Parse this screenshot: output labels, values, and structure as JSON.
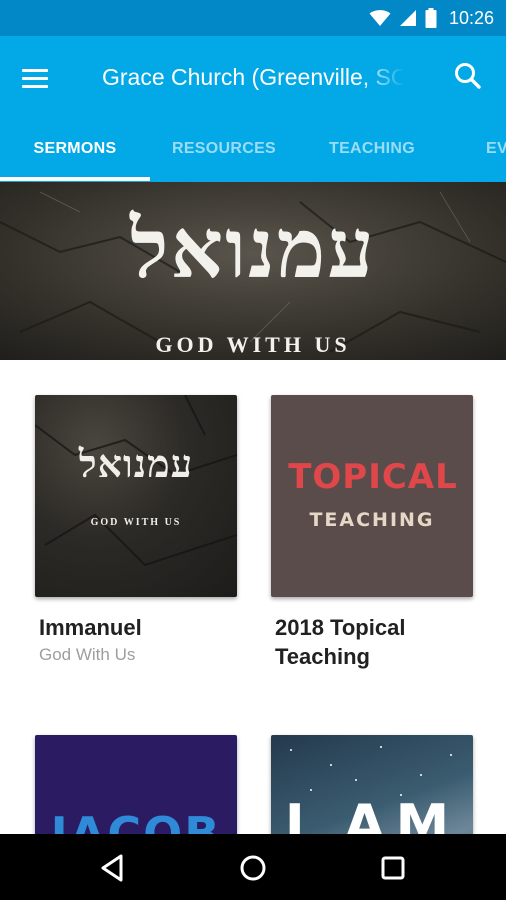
{
  "status_bar": {
    "time": "10:26"
  },
  "app_bar": {
    "title": "Grace Church (Greenville, SC)"
  },
  "tabs": [
    {
      "label": "SERMONS",
      "active": true
    },
    {
      "label": "RESOURCES",
      "active": false
    },
    {
      "label": "TEACHING",
      "active": false
    },
    {
      "label": "EVENTS",
      "active": false
    }
  ],
  "hero": {
    "hebrew": "עמנואל",
    "subtitle": "GOD WITH US"
  },
  "series": [
    {
      "title": "Immanuel",
      "subtitle": "God With Us",
      "art_hebrew": "עמנואל",
      "art_sub": "GOD WITH US"
    },
    {
      "title": "2018 Topical Teaching",
      "subtitle": "",
      "art_word": "TOPICAL",
      "art_sub": "TEACHING"
    },
    {
      "title": "",
      "subtitle": "",
      "art_word": "JACOB"
    },
    {
      "title": "",
      "subtitle": "",
      "art_word": "I AM"
    }
  ],
  "colors": {
    "status_bar": "#0288c6",
    "app_bar": "#03a9e6",
    "nav_bar": "#000000"
  },
  "icons": {
    "menu": "menu-icon",
    "search": "search-icon",
    "wifi": "wifi-icon",
    "cell": "signal-icon",
    "battery": "battery-icon",
    "back": "back-icon",
    "home": "home-icon",
    "recents": "recents-icon"
  }
}
